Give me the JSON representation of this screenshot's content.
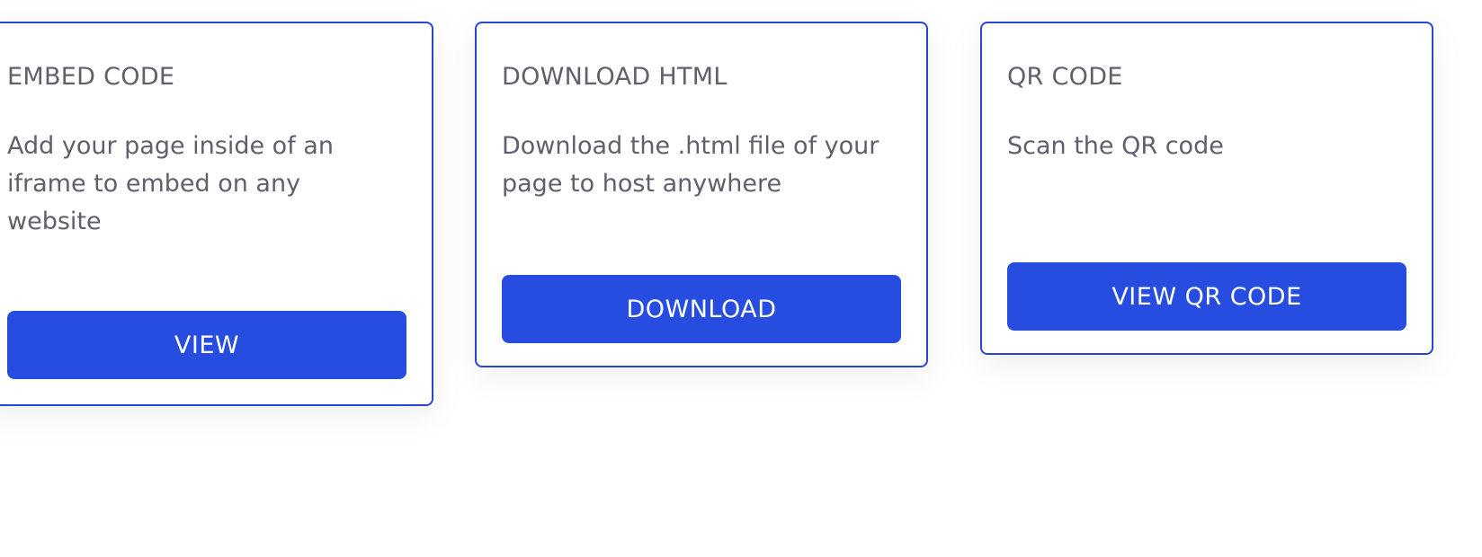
{
  "cards": [
    {
      "title": "EMBED CODE",
      "description": "Add your page inside of an iframe to embed on any website",
      "button_label": "VIEW"
    },
    {
      "title": "DOWNLOAD HTML",
      "description": "Download the .html file of your page to host anywhere",
      "button_label": "DOWNLOAD"
    },
    {
      "title": "QR CODE",
      "description": "Scan the QR code",
      "button_label": "VIEW QR CODE"
    }
  ],
  "colors": {
    "accent": "#264de0",
    "card_border": "#2a45d4",
    "text": "#5f606b",
    "button_text": "#ffffff"
  }
}
